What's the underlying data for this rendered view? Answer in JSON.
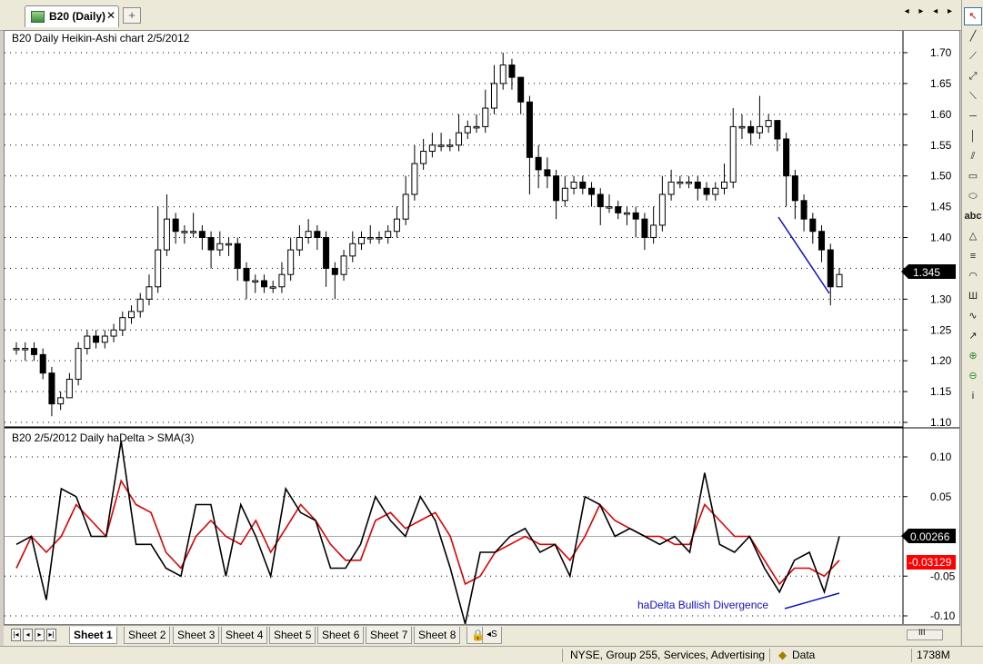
{
  "tab": {
    "label": "B20 (Daily)",
    "close": "✕",
    "new": "+"
  },
  "nav": {
    "arrows": "◂ ▸ ◂ ▸"
  },
  "colors": {
    "price_label_bg": "#000000",
    "hadelta_label_bg": "#000000",
    "sma_label_bg": "#ff0000",
    "hadelta_line": "#000000",
    "sma_line": "#dd0000",
    "trendline": "#1010c0"
  },
  "price_pane": {
    "title": "B20   Daily Heikin-Ashi chart  2/5/2012",
    "yticks": [
      "1.70",
      "1.65",
      "1.60",
      "1.55",
      "1.50",
      "1.45",
      "1.40",
      "1.35",
      "1.30",
      "1.25",
      "1.20",
      "1.15",
      "1.10"
    ],
    "ytick_values": [
      1.7,
      1.65,
      1.6,
      1.55,
      1.5,
      1.45,
      1.4,
      1.35,
      1.3,
      1.25,
      1.2,
      1.15,
      1.1
    ],
    "last_value": "1.345"
  },
  "indicator_pane": {
    "title": "B20   2/5/2012  Daily haDelta > SMA(3)",
    "yticks": [
      "0.10",
      "0.05",
      "0.00",
      "-0.05",
      "-0.10"
    ],
    "ytick_values": [
      0.1,
      0.05,
      0.0,
      -0.05,
      -0.1
    ],
    "hadelta_value": "0.00266",
    "sma_value": "-0.03129",
    "annotation": "haDelta Bullish Divergence"
  },
  "toolbar": {
    "tools": [
      "select-arrow",
      "line",
      "ray",
      "extended-line",
      "segment",
      "horizontal-line",
      "vertical-line",
      "parallel-lines",
      "rectangle",
      "ellipse",
      "text",
      "triangle",
      "fibonacci",
      "arc",
      "pitchfork",
      "zigzag",
      "arrow",
      "zoom-in",
      "zoom-out",
      "info"
    ],
    "text_tool_label": "abc",
    "info_label": "i"
  },
  "sheets": {
    "labels": [
      "Sheet 1",
      "Sheet 2",
      "Sheet 3",
      "Sheet 4",
      "Sheet 5",
      "Sheet 6",
      "Sheet 7",
      "Sheet 8"
    ],
    "active_index": 0,
    "scroll_label": "III"
  },
  "statusbar": {
    "group": "NYSE, Group 255, Services, Advertising",
    "data_label": "Data",
    "memory": "1738M"
  },
  "chart_data": [
    {
      "type": "candlestick",
      "title": "B20   Daily Heikin-Ashi chart  2/5/2012",
      "ylim": [
        1.1,
        1.7
      ],
      "candles": [
        [
          1.22,
          1.22,
          1.23,
          1.21
        ],
        [
          1.22,
          1.22,
          1.23,
          1.2
        ],
        [
          1.22,
          1.21,
          1.23,
          1.2
        ],
        [
          1.21,
          1.18,
          1.22,
          1.17
        ],
        [
          1.18,
          1.13,
          1.19,
          1.11
        ],
        [
          1.13,
          1.14,
          1.15,
          1.12
        ],
        [
          1.14,
          1.17,
          1.18,
          1.14
        ],
        [
          1.17,
          1.22,
          1.23,
          1.16
        ],
        [
          1.22,
          1.24,
          1.25,
          1.21
        ],
        [
          1.24,
          1.23,
          1.25,
          1.22
        ],
        [
          1.23,
          1.24,
          1.25,
          1.22
        ],
        [
          1.24,
          1.25,
          1.26,
          1.23
        ],
        [
          1.25,
          1.27,
          1.28,
          1.24
        ],
        [
          1.27,
          1.28,
          1.29,
          1.26
        ],
        [
          1.28,
          1.3,
          1.31,
          1.27
        ],
        [
          1.3,
          1.32,
          1.34,
          1.29
        ],
        [
          1.32,
          1.38,
          1.45,
          1.31
        ],
        [
          1.38,
          1.43,
          1.47,
          1.37
        ],
        [
          1.43,
          1.41,
          1.44,
          1.39
        ],
        [
          1.41,
          1.41,
          1.42,
          1.39
        ],
        [
          1.41,
          1.41,
          1.44,
          1.4
        ],
        [
          1.41,
          1.4,
          1.42,
          1.38
        ],
        [
          1.4,
          1.38,
          1.41,
          1.35
        ],
        [
          1.38,
          1.39,
          1.41,
          1.37
        ],
        [
          1.39,
          1.39,
          1.4,
          1.37
        ],
        [
          1.39,
          1.35,
          1.4,
          1.33
        ],
        [
          1.35,
          1.33,
          1.36,
          1.3
        ],
        [
          1.33,
          1.33,
          1.34,
          1.31
        ],
        [
          1.33,
          1.32,
          1.34,
          1.31
        ],
        [
          1.32,
          1.32,
          1.33,
          1.31
        ],
        [
          1.32,
          1.34,
          1.36,
          1.31
        ],
        [
          1.34,
          1.38,
          1.4,
          1.33
        ],
        [
          1.38,
          1.4,
          1.42,
          1.37
        ],
        [
          1.4,
          1.41,
          1.43,
          1.39
        ],
        [
          1.41,
          1.4,
          1.42,
          1.38
        ],
        [
          1.4,
          1.35,
          1.41,
          1.32
        ],
        [
          1.35,
          1.34,
          1.36,
          1.3
        ],
        [
          1.34,
          1.37,
          1.38,
          1.33
        ],
        [
          1.37,
          1.39,
          1.41,
          1.36
        ],
        [
          1.39,
          1.4,
          1.41,
          1.38
        ],
        [
          1.4,
          1.4,
          1.42,
          1.39
        ],
        [
          1.4,
          1.4,
          1.41,
          1.39
        ],
        [
          1.4,
          1.41,
          1.42,
          1.39
        ],
        [
          1.41,
          1.43,
          1.45,
          1.4
        ],
        [
          1.43,
          1.47,
          1.5,
          1.42
        ],
        [
          1.47,
          1.52,
          1.55,
          1.46
        ],
        [
          1.52,
          1.54,
          1.56,
          1.51
        ],
        [
          1.54,
          1.55,
          1.57,
          1.53
        ],
        [
          1.55,
          1.55,
          1.57,
          1.54
        ],
        [
          1.55,
          1.55,
          1.56,
          1.54
        ],
        [
          1.55,
          1.57,
          1.6,
          1.54
        ],
        [
          1.57,
          1.58,
          1.59,
          1.56
        ],
        [
          1.58,
          1.58,
          1.6,
          1.57
        ],
        [
          1.58,
          1.61,
          1.64,
          1.57
        ],
        [
          1.61,
          1.65,
          1.68,
          1.6
        ],
        [
          1.65,
          1.68,
          1.7,
          1.64
        ],
        [
          1.68,
          1.66,
          1.69,
          1.64
        ],
        [
          1.66,
          1.62,
          1.66,
          1.6
        ],
        [
          1.62,
          1.53,
          1.63,
          1.47
        ],
        [
          1.53,
          1.51,
          1.55,
          1.48
        ],
        [
          1.51,
          1.5,
          1.53,
          1.48
        ],
        [
          1.5,
          1.46,
          1.51,
          1.43
        ],
        [
          1.46,
          1.48,
          1.5,
          1.45
        ],
        [
          1.48,
          1.49,
          1.5,
          1.47
        ],
        [
          1.49,
          1.48,
          1.5,
          1.47
        ],
        [
          1.48,
          1.47,
          1.49,
          1.45
        ],
        [
          1.47,
          1.45,
          1.48,
          1.42
        ],
        [
          1.45,
          1.45,
          1.47,
          1.44
        ],
        [
          1.45,
          1.44,
          1.46,
          1.43
        ],
        [
          1.44,
          1.44,
          1.45,
          1.42
        ],
        [
          1.44,
          1.43,
          1.45,
          1.4
        ],
        [
          1.43,
          1.4,
          1.44,
          1.38
        ],
        [
          1.4,
          1.42,
          1.45,
          1.39
        ],
        [
          1.42,
          1.47,
          1.5,
          1.41
        ],
        [
          1.47,
          1.49,
          1.51,
          1.46
        ],
        [
          1.49,
          1.49,
          1.5,
          1.48
        ],
        [
          1.49,
          1.49,
          1.5,
          1.48
        ],
        [
          1.49,
          1.48,
          1.5,
          1.46
        ],
        [
          1.48,
          1.47,
          1.49,
          1.46
        ],
        [
          1.47,
          1.48,
          1.49,
          1.46
        ],
        [
          1.48,
          1.49,
          1.52,
          1.47
        ],
        [
          1.49,
          1.58,
          1.61,
          1.48
        ],
        [
          1.58,
          1.58,
          1.6,
          1.56
        ],
        [
          1.58,
          1.57,
          1.59,
          1.55
        ],
        [
          1.57,
          1.58,
          1.63,
          1.56
        ],
        [
          1.58,
          1.59,
          1.6,
          1.57
        ],
        [
          1.59,
          1.56,
          1.59,
          1.54
        ],
        [
          1.56,
          1.5,
          1.57,
          1.45
        ],
        [
          1.5,
          1.46,
          1.51,
          1.43
        ],
        [
          1.46,
          1.43,
          1.47,
          1.41
        ],
        [
          1.43,
          1.41,
          1.44,
          1.39
        ],
        [
          1.41,
          1.38,
          1.42,
          1.36
        ],
        [
          1.38,
          1.32,
          1.39,
          1.29
        ],
        [
          1.32,
          1.34,
          1.35,
          1.32
        ]
      ]
    },
    {
      "type": "line",
      "title": "B20   2/5/2012  Daily haDelta > SMA(3)",
      "ylim": [
        -0.1,
        0.1
      ],
      "series": [
        {
          "name": "haDelta",
          "values": [
            -0.01,
            0.0,
            -0.08,
            0.06,
            0.05,
            0.0,
            0.0,
            0.12,
            -0.01,
            -0.01,
            -0.04,
            -0.05,
            0.04,
            0.04,
            -0.05,
            0.04,
            0.0,
            -0.05,
            0.06,
            0.03,
            0.02,
            -0.04,
            -0.04,
            -0.01,
            0.05,
            0.02,
            0.0,
            0.05,
            0.02,
            -0.04,
            -0.11,
            -0.02,
            -0.02,
            0.0,
            0.01,
            -0.02,
            -0.01,
            -0.05,
            0.05,
            0.04,
            0.0,
            0.01,
            0.0,
            -0.01,
            0.0,
            -0.02,
            0.08,
            -0.01,
            -0.02,
            0.0,
            -0.04,
            -0.07,
            -0.03,
            -0.02,
            -0.07,
            0.0
          ]
        },
        {
          "name": "SMA(3)",
          "values": [
            -0.04,
            0.0,
            -0.02,
            0.0,
            0.04,
            0.02,
            0.0,
            0.07,
            0.04,
            0.03,
            -0.02,
            -0.04,
            0.0,
            0.02,
            0.0,
            -0.01,
            0.02,
            -0.02,
            0.01,
            0.04,
            0.02,
            -0.01,
            -0.03,
            -0.03,
            0.02,
            0.03,
            0.01,
            0.02,
            0.03,
            0.0,
            -0.06,
            -0.05,
            -0.02,
            -0.01,
            0.0,
            -0.01,
            -0.01,
            -0.03,
            0.0,
            0.04,
            0.02,
            0.01,
            0.0,
            0.0,
            -0.01,
            -0.01,
            0.04,
            0.02,
            0.0,
            0.0,
            -0.03,
            -0.06,
            -0.04,
            -0.04,
            -0.05,
            -0.03
          ]
        }
      ],
      "trendline_note": "haDelta Bullish Divergence"
    }
  ]
}
